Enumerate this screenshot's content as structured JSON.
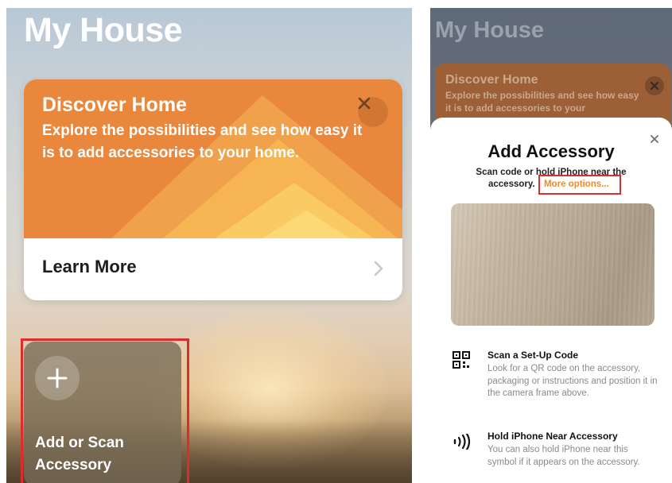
{
  "left_screen": {
    "title": "My House",
    "discover_card": {
      "title": "Discover Home",
      "text": "Explore the possibilities and see how easy it is to add accessories to your home.",
      "close_icon": "close-icon",
      "learn_more_label": "Learn More",
      "chevron_icon": "chevron-right-icon",
      "accent_color": "#e9873c"
    },
    "add_tile": {
      "icon": "plus-icon",
      "label": "Add or Scan Accessory"
    }
  },
  "right_screen": {
    "background_title": "My House",
    "background_card": {
      "title": "Discover Home",
      "text": "Explore the possibilities and see how easy it is to add accessories to your"
    },
    "sheet": {
      "close_icon": "close-icon",
      "title": "Add Accessory",
      "subtitle_line1": "Scan code or hold iPhone near the",
      "subtitle_line2": "accessory.",
      "more_options": "More options...",
      "more_options_color": "#f08a24",
      "options": [
        {
          "icon": "qr-code-icon",
          "title": "Scan a Set-Up Code",
          "description": "Look for a QR code on the accessory, packaging or instructions and position it in the camera frame above."
        },
        {
          "icon": "nfc-icon",
          "title": "Hold iPhone Near Accessory",
          "description": "You can also hold iPhone near this symbol if it appears on the accessory."
        }
      ]
    }
  },
  "highlight_color": "#e02b2b"
}
